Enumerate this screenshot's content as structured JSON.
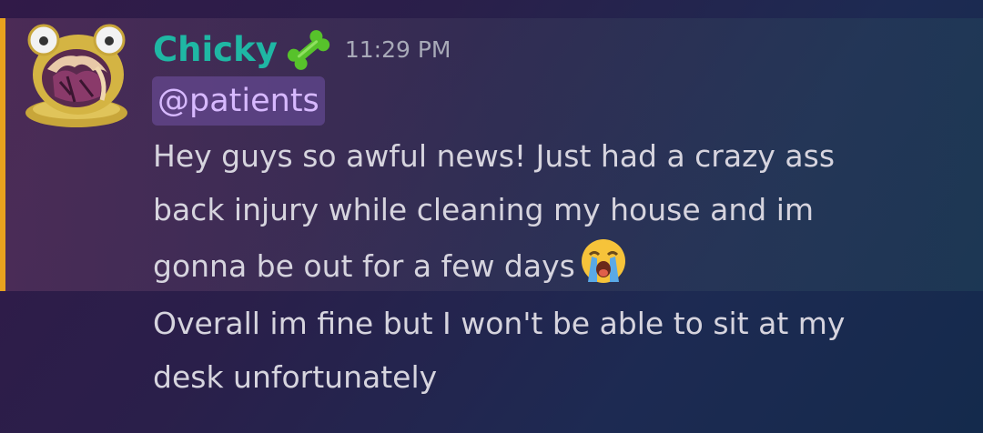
{
  "message": {
    "author": "Chicky",
    "author_badge_icon": "bone-icon",
    "timestamp": "11:29 PM",
    "mention": "@patients",
    "highlight_color": "#e8a21e",
    "lines": [
      "Hey guys so awful news!  Just had a crazy ass",
      "back injury while cleaning my house and im",
      "gonna be out for a few days"
    ],
    "emoji": "loudly-crying-face-icon"
  },
  "followup": {
    "lines": [
      "Overall im fine but I won't be able to sit at my",
      "desk unfortunately"
    ]
  }
}
